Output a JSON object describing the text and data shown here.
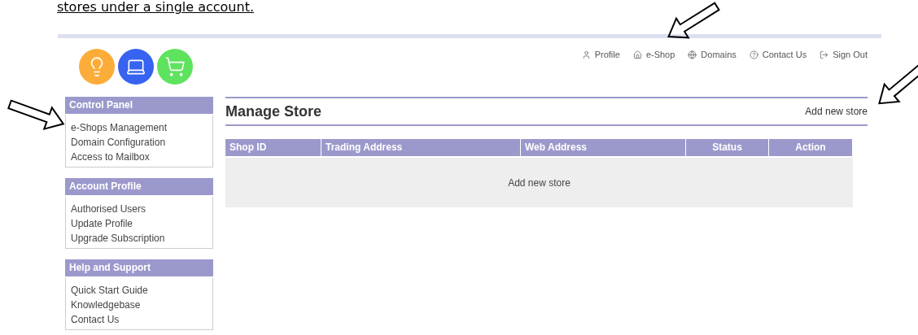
{
  "document_note": "stores under a single account.",
  "logos": [
    {
      "kind": "bulb",
      "color": "#fcad39"
    },
    {
      "kind": "laptop",
      "color": "#3763f0"
    },
    {
      "kind": "cart",
      "color": "#5ee35e"
    }
  ],
  "top_nav": [
    {
      "kind": "profile",
      "label": "Profile"
    },
    {
      "kind": "home",
      "label": "e-Shop"
    },
    {
      "kind": "globe",
      "label": "Domains"
    },
    {
      "kind": "help",
      "label": "Contact Us"
    },
    {
      "kind": "signout",
      "label": "Sign Out"
    }
  ],
  "sidebar": [
    {
      "title": "Control Panel",
      "items": [
        "e-Shops Management",
        "Domain Configuration",
        "Access to Mailbox"
      ]
    },
    {
      "title": "Account Profile",
      "items": [
        "Authorised Users",
        "Update Profile",
        "Upgrade Subscription"
      ]
    },
    {
      "title": "Help and Support",
      "items": [
        "Quick Start Guide",
        "Knowledgebase",
        "Contact Us"
      ]
    }
  ],
  "main": {
    "title": "Manage Store",
    "action_link": "Add new store",
    "table": {
      "columns": [
        {
          "label": "Shop ID",
          "centered": false
        },
        {
          "label": "Trading Address",
          "centered": false
        },
        {
          "label": "Web Address",
          "centered": false
        },
        {
          "label": "Status",
          "centered": true
        },
        {
          "label": "Action",
          "centered": true
        }
      ],
      "empty_message": "Add new store"
    }
  },
  "annotations": [
    {
      "kind": "arrow"
    },
    {
      "kind": "arrow"
    },
    {
      "kind": "arrow"
    }
  ]
}
